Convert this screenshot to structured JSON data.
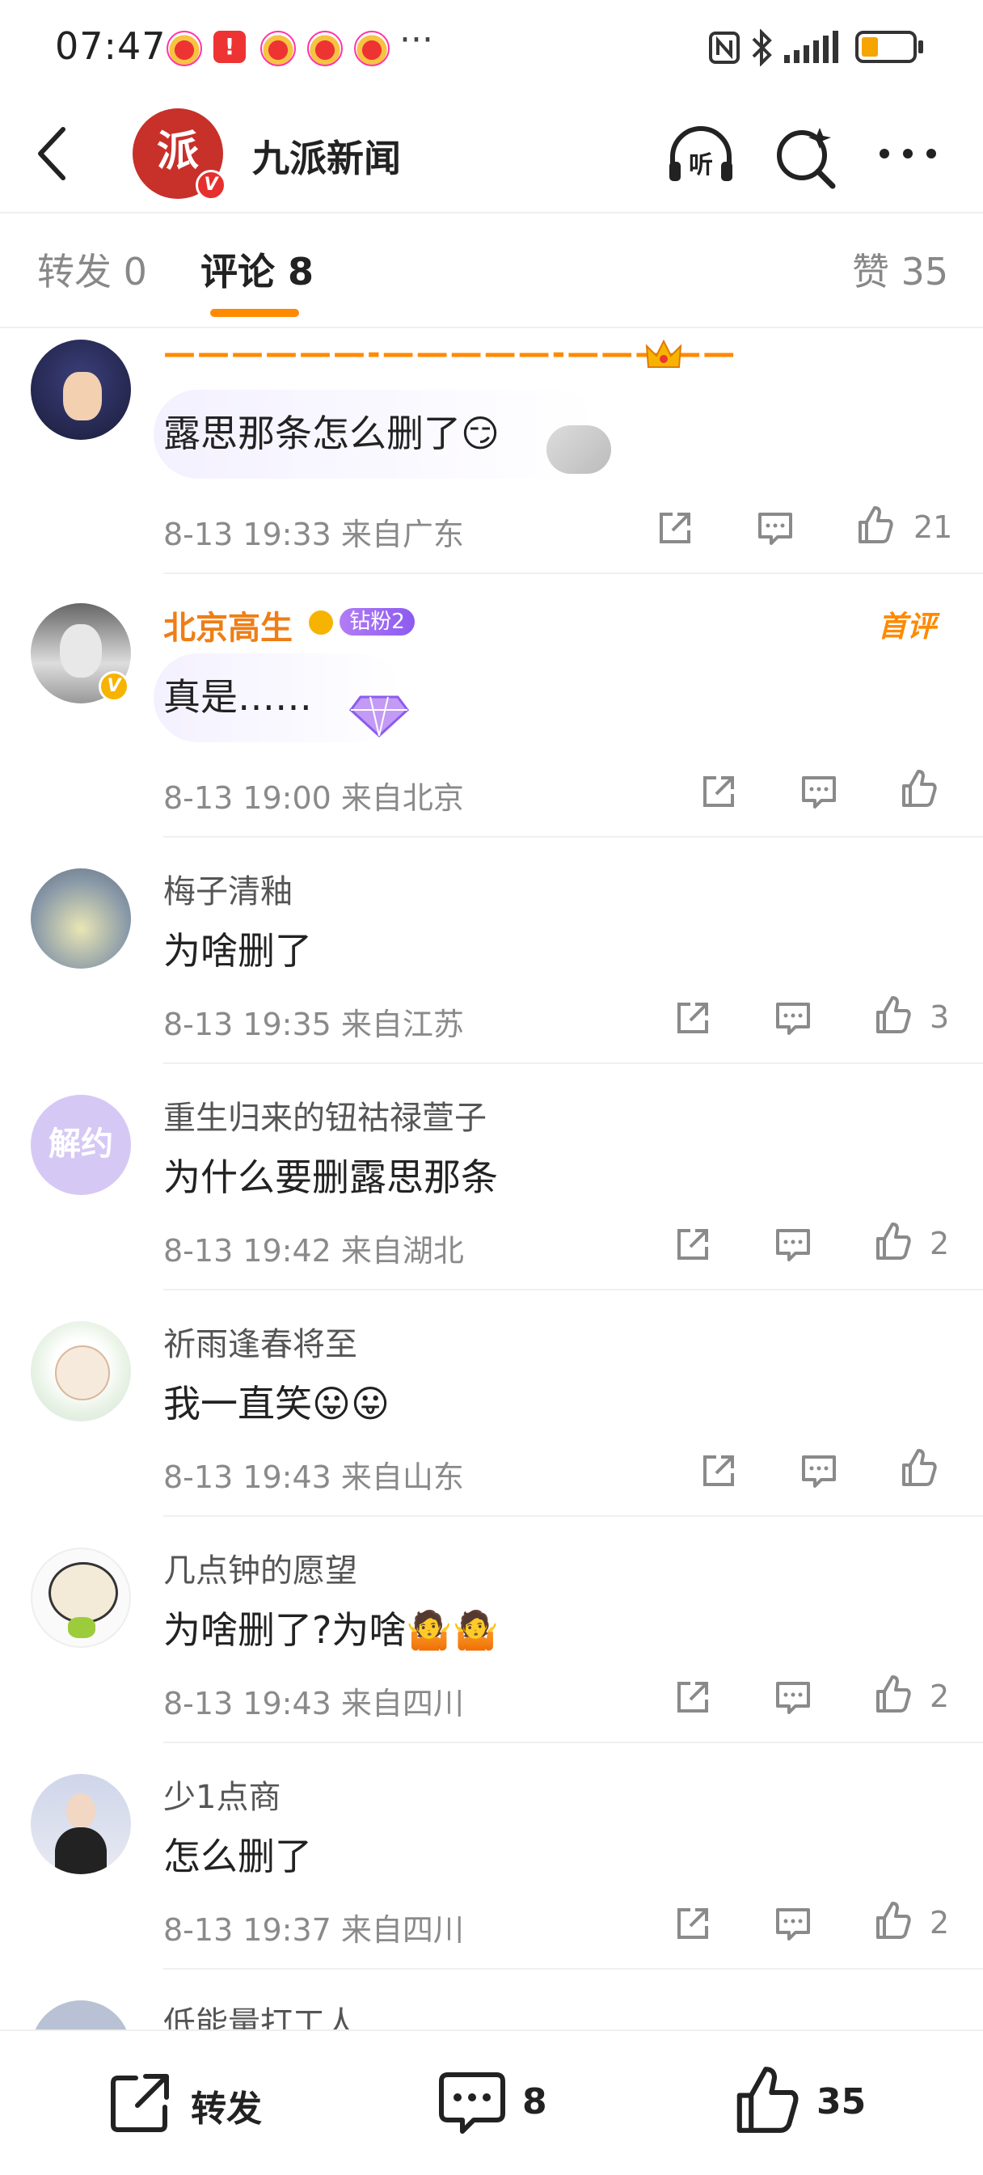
{
  "status_bar": {
    "time": "07:47",
    "more": "···"
  },
  "header": {
    "name": "九派新闻",
    "avatar_text": "派",
    "listen_label": "听"
  },
  "tabs": {
    "repost": "转发 0",
    "comments": "评论 8",
    "likes": "赞 35"
  },
  "comments": [
    {
      "name": "——————-—————-—————",
      "text": "露思那条怎么删了😏",
      "meta": "8-13 19:33  来自广东",
      "likes": "21"
    },
    {
      "name": "北京高生",
      "badge": "钻粉2",
      "tag": "首评",
      "text": "真是……",
      "meta": "8-13 19:00  来自北京",
      "likes": ""
    },
    {
      "name": "梅子清釉",
      "text": "为啥删了",
      "meta": "8-13 19:35  来自江苏",
      "likes": "3"
    },
    {
      "name": "重生归来的钮祜禄萱子",
      "avatar_text": "解约",
      "text": "为什么要删露思那条",
      "meta": "8-13 19:42  来自湖北",
      "likes": "2"
    },
    {
      "name": "祈雨逢春将至",
      "text": "我一直笑😛😛",
      "meta": "8-13 19:43  来自山东",
      "likes": ""
    },
    {
      "name": "几点钟的愿望",
      "text": "为啥删了?为啥🤷🤷",
      "meta": "8-13 19:43  来自四川",
      "likes": "2"
    },
    {
      "name": "少1点商",
      "text": "怎么删了",
      "meta": "8-13 19:37  来自四川",
      "likes": "2"
    },
    {
      "name": "低能量打工人"
    }
  ],
  "bottom_bar": {
    "repost_label": "转发",
    "comments_count": "8",
    "likes_count": "35"
  },
  "colors": {
    "accent": "#ff8a00",
    "brand_red": "#c8302a",
    "text_muted": "#8a8a8a"
  }
}
